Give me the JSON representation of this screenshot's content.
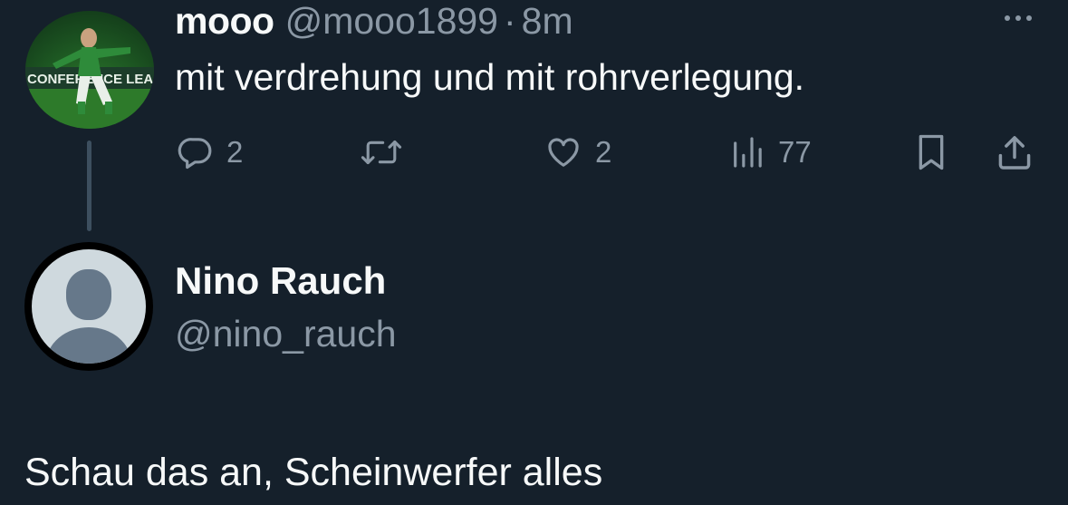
{
  "tweet": {
    "display_name": "mooo",
    "handle": "@mooo1899",
    "separator": "·",
    "time": "8m",
    "text": "mit verdrehung und mit rohrverlegung.",
    "avatar_icon": "soccer-player-avatar",
    "avatar_banner_text": "CONFERENCE LEAGUE",
    "actions": {
      "reply": {
        "icon": "reply-icon",
        "count": "2"
      },
      "retweet": {
        "icon": "retweet-icon",
        "count": ""
      },
      "like": {
        "icon": "heart-icon",
        "count": "2"
      },
      "views": {
        "icon": "views-icon",
        "count": "77"
      },
      "bookmark": {
        "icon": "bookmark-icon"
      },
      "share": {
        "icon": "share-icon"
      }
    }
  },
  "reply_compose": {
    "display_name": "Nino Rauch",
    "handle": "@nino_rauch",
    "avatar_icon": "default-avatar",
    "text": "Schau das an, Scheinwerfer alles"
  },
  "colors": {
    "background": "#15202b",
    "primary_text": "#f7f9f9",
    "secondary_text": "#8b98a5",
    "thread_line": "#3d4f5f"
  }
}
